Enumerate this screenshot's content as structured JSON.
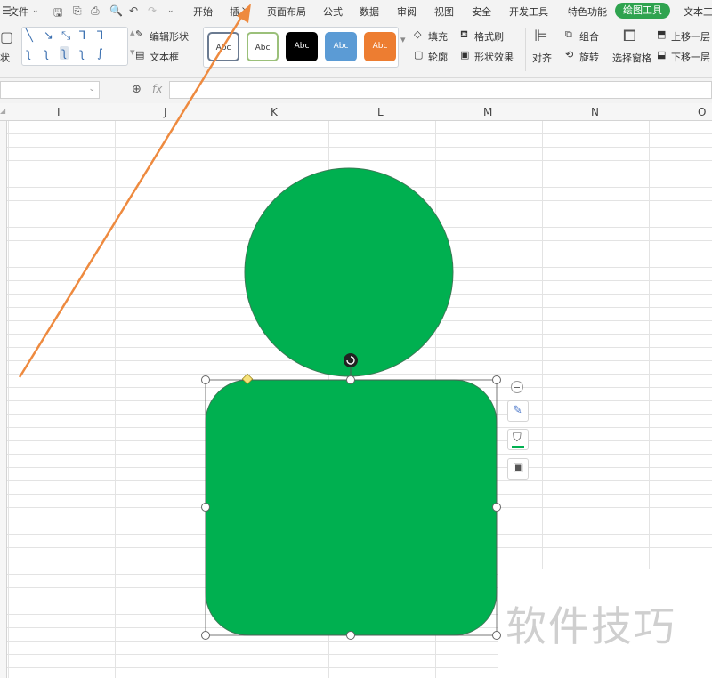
{
  "menu": {
    "file_label": "文件",
    "tabs": [
      "开始",
      "插入",
      "页面布局",
      "公式",
      "数据",
      "审阅",
      "视图",
      "安全",
      "开发工具",
      "特色功能"
    ],
    "active_tab": "绘图工具",
    "extra_tab": "文本工"
  },
  "ribbon": {
    "shape_label": "状",
    "edit_shape": "编辑形状",
    "text_box": "文本框",
    "style_label": "Abc",
    "fill": "填充",
    "outline": "轮廓",
    "format_painter": "格式刷",
    "shape_effects": "形状效果",
    "align": "对齐",
    "group": "组合",
    "rotate": "旋转",
    "selection_pane": "选择窗格",
    "bring_forward": "上移一层",
    "send_backward": "下移一层"
  },
  "formula_bar": {
    "fx": "fx"
  },
  "columns": [
    "I",
    "J",
    "K",
    "L",
    "M",
    "N",
    "O"
  ],
  "watermark": "软件技巧",
  "colors": {
    "shape_fill": "#00b050",
    "accent": "#2fa34f",
    "arrow": "#ee8a3f"
  }
}
